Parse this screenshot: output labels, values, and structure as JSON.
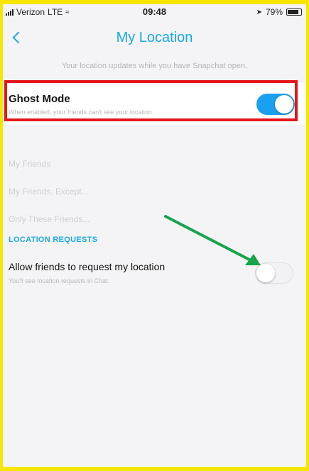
{
  "status": {
    "carrier": "Verizon",
    "network": "LTE",
    "time": "09:48",
    "battery": "79%"
  },
  "nav": {
    "back_icon": "chevron-left-icon",
    "title": "My Location"
  },
  "subtitle": "Your location updates while you have Snapchat open.",
  "ghost_mode": {
    "label": "Ghost Mode",
    "description": "When enabled, your friends can't see your location.",
    "enabled": true,
    "toggle_color": "#1aa1f0"
  },
  "visibility_options": [
    "My Friends",
    "My Friends, Except...",
    "Only These Friends..."
  ],
  "location_requests": {
    "header": "LOCATION REQUESTS",
    "label": "Allow friends to request my location",
    "description": "You'll see location requests in Chat.",
    "enabled": false
  },
  "annotations": {
    "highlight_color": "#e4161d",
    "arrow_color": "#17a54a"
  }
}
